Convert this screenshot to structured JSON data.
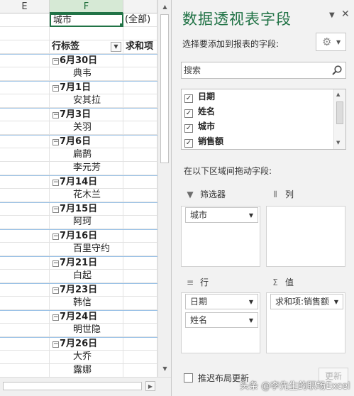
{
  "sheet": {
    "columns": [
      "E",
      "F",
      ""
    ],
    "filter_field": "城市",
    "filter_value": "(全部)",
    "header_row_label": "行标签",
    "header_value_label": "求和项",
    "rows": [
      {
        "type": "date",
        "label": "6月30日"
      },
      {
        "type": "name",
        "label": "典韦"
      },
      {
        "type": "date",
        "label": "7月1日"
      },
      {
        "type": "name",
        "label": "安其拉"
      },
      {
        "type": "date",
        "label": "7月3日"
      },
      {
        "type": "name",
        "label": "关羽"
      },
      {
        "type": "date",
        "label": "7月6日"
      },
      {
        "type": "name",
        "label": "扁鹊"
      },
      {
        "type": "name",
        "label": "李元芳"
      },
      {
        "type": "date",
        "label": "7月14日"
      },
      {
        "type": "name",
        "label": "花木兰"
      },
      {
        "type": "date",
        "label": "7月15日"
      },
      {
        "type": "name",
        "label": "阿珂"
      },
      {
        "type": "date",
        "label": "7月16日"
      },
      {
        "type": "name",
        "label": "百里守约"
      },
      {
        "type": "date",
        "label": "7月21日"
      },
      {
        "type": "name",
        "label": "白起"
      },
      {
        "type": "date",
        "label": "7月23日"
      },
      {
        "type": "name",
        "label": "韩信"
      },
      {
        "type": "date",
        "label": "7月24日"
      },
      {
        "type": "name",
        "label": "明世隐"
      },
      {
        "type": "date",
        "label": "7月26日"
      },
      {
        "type": "name",
        "label": "大乔"
      },
      {
        "type": "name",
        "label": "露娜"
      }
    ]
  },
  "pane": {
    "title": "数据透视表字段",
    "choose_label": "选择要添加到报表的字段:",
    "search_placeholder": "搜索",
    "fields": [
      {
        "label": "日期",
        "checked": true
      },
      {
        "label": "姓名",
        "checked": true
      },
      {
        "label": "城市",
        "checked": true
      },
      {
        "label": "销售额",
        "checked": true
      }
    ],
    "drag_label": "在以下区域间拖动字段:",
    "areas": {
      "filters": {
        "label": "筛选器",
        "items": [
          "城市"
        ]
      },
      "columns": {
        "label": "列",
        "items": []
      },
      "rows": {
        "label": "行",
        "items": [
          "日期",
          "姓名"
        ]
      },
      "values": {
        "label": "值",
        "items": [
          "求和项:销售额"
        ]
      }
    },
    "defer_label": "推迟布局更新",
    "update_label": "更新"
  },
  "watermark": "头条 @李先生的职场Excel",
  "colors": {
    "accent": "#217346",
    "pane_bg": "#f2f2f2",
    "date_sep": "#9bc2e6"
  }
}
